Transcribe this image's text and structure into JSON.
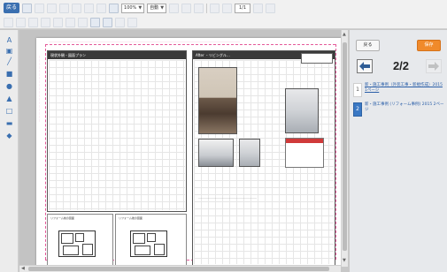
{
  "toolbar": {
    "back_label": "戻る",
    "zoom_select": "100%",
    "font_select": "自動",
    "page_field": "1/1"
  },
  "tools": {
    "items": [
      {
        "icon": "text-icon",
        "glyph": "A"
      },
      {
        "icon": "image-icon",
        "glyph": "▣"
      },
      {
        "icon": "line-icon",
        "glyph": "╱"
      },
      {
        "icon": "rectangle-icon",
        "glyph": "■"
      },
      {
        "icon": "circle-icon",
        "glyph": "●"
      },
      {
        "icon": "triangle-icon",
        "glyph": "▲"
      },
      {
        "icon": "frame-icon",
        "glyph": "□"
      },
      {
        "icon": "comment-icon",
        "glyph": "▬"
      },
      {
        "icon": "stamp-icon",
        "glyph": "◆"
      }
    ]
  },
  "document": {
    "left_panel_title": "現状外観・図面プラン",
    "right_panel_title": "After ・リビングル…",
    "plan_before_caption": "リフォーム前の図面",
    "plan_after_caption": "リフォーム後の図面"
  },
  "right_panel": {
    "back_label": "戻る",
    "save_label": "保存",
    "page_indicator": "2/2",
    "accent_color": "#f08a2b",
    "pages": [
      {
        "number": "1",
        "label": "新・施工事例（外装工事・新規作成）2015 1ページ",
        "active": false
      },
      {
        "number": "2",
        "label": "新・施工事例 (リフォーム事例) 2015 2ページ",
        "active": true
      }
    ]
  }
}
